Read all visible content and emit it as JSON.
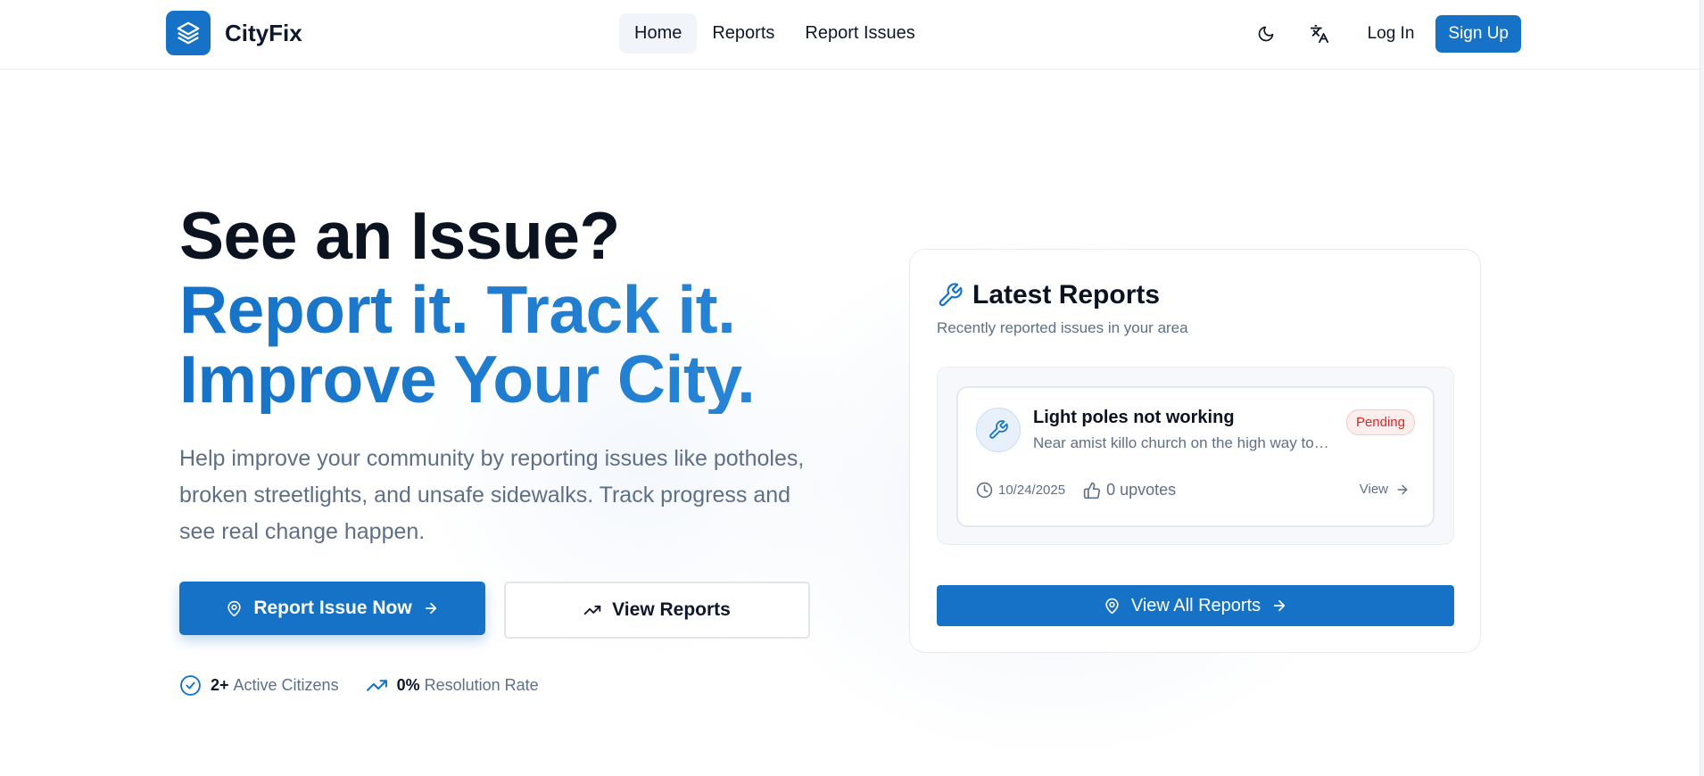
{
  "colors": {
    "brand": "#1672c6",
    "text": "#0f172a",
    "muted": "#5f6f85",
    "pending": "#dc2626"
  },
  "header": {
    "brand_name": "CityFix",
    "logo_icon": "layers-icon",
    "nav": [
      {
        "label": "Home",
        "active": true
      },
      {
        "label": "Reports",
        "active": false
      },
      {
        "label": "Report Issues",
        "active": false
      }
    ],
    "theme_icon": "moon-icon",
    "language_icon": "translate-icon",
    "login_label": "Log In",
    "signup_label": "Sign Up"
  },
  "hero": {
    "title": "See an Issue?",
    "subtitle_line1": "Report it. Track it.",
    "subtitle_line2": "Improve Your City.",
    "description": "Help improve your community by reporting issues like potholes, broken streetlights, and unsafe sidewalks. Track progress and see real change happen.",
    "primary_button": "Report Issue Now",
    "secondary_button": "View Reports",
    "stats": [
      {
        "value": "2+",
        "label": "Active Citizens",
        "icon": "check-circle-icon"
      },
      {
        "value": "0%",
        "label": "Resolution Rate",
        "icon": "trending-up-icon"
      }
    ]
  },
  "latest_reports": {
    "title": "Latest Reports",
    "description": "Recently reported issues in your area",
    "items": [
      {
        "title": "Light poles not working",
        "location": "Near amist killo church on the high way to the junction",
        "status": "Pending",
        "date": "10/24/2025",
        "upvotes": "0 upvotes",
        "view_label": "View"
      }
    ],
    "view_all_label": "View All Reports"
  }
}
